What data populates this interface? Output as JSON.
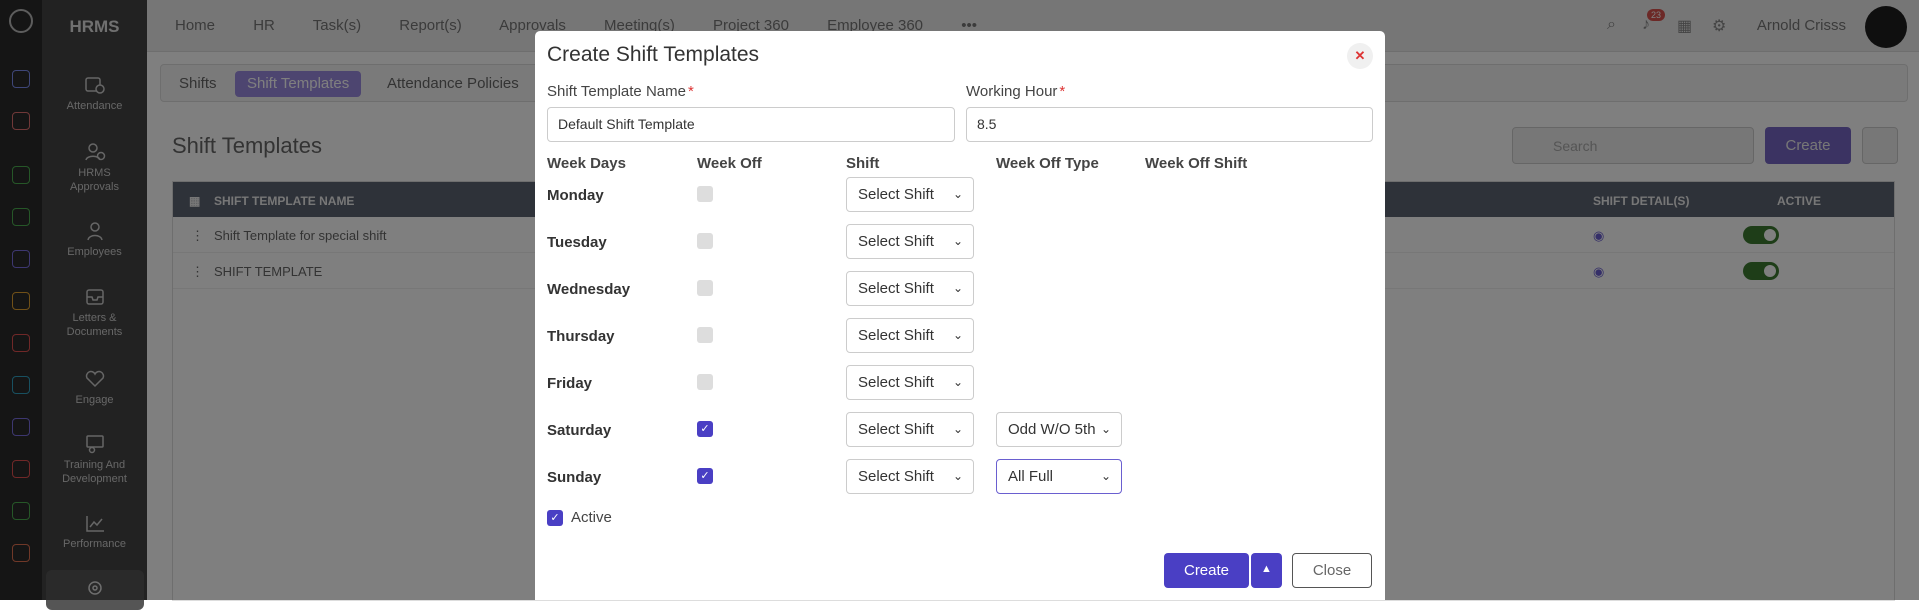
{
  "app": {
    "brand": "HRMS"
  },
  "sidebar": {
    "items": [
      {
        "label": "Attendance",
        "icon": "calendar-clock-icon"
      },
      {
        "label": "HRMS Approvals",
        "icon": "user-check-icon"
      },
      {
        "label": "Employees",
        "icon": "user-icon"
      },
      {
        "label": "Letters & Documents",
        "icon": "envelope-icon"
      },
      {
        "label": "Engage",
        "icon": "heart-hand-icon"
      },
      {
        "label": "Training And Development",
        "icon": "presentation-icon"
      },
      {
        "label": "Performance",
        "icon": "line-chart-icon"
      }
    ]
  },
  "topnav": {
    "items": [
      "Home",
      "HR",
      "Task(s)",
      "Report(s)",
      "Approvals",
      "Meeting(s)",
      "Project 360",
      "Employee 360"
    ],
    "notification_count": "23",
    "user_name": "Arnold Crisss"
  },
  "subtabs": {
    "items": [
      "Shifts",
      "Shift Templates",
      "Attendance Policies"
    ],
    "active": "Shift Templates"
  },
  "page": {
    "title": "Shift Templates",
    "search_placeholder": "Search",
    "create_label": "Create",
    "table": {
      "headers": {
        "name": "SHIFT TEMPLATE NAME",
        "details": "SHIFT DETAIL(S)",
        "active": "ACTIVE"
      },
      "rows": [
        {
          "name": "Shift Template for special shift",
          "active": true
        },
        {
          "name": "SHIFT TEMPLATE",
          "active": true
        }
      ]
    }
  },
  "modal": {
    "title": "Create Shift Templates",
    "name_label": "Shift Template Name",
    "name_value": "Default Shift Template",
    "hours_label": "Working Hour",
    "hours_value": "8.5",
    "columns": [
      "Week Days",
      "Week Off",
      "Shift",
      "Week Off Type",
      "Week Off Shift"
    ],
    "days": [
      {
        "day": "Monday",
        "week_off": false,
        "shift": "Select Shift",
        "week_off_type": ""
      },
      {
        "day": "Tuesday",
        "week_off": false,
        "shift": "Select Shift",
        "week_off_type": ""
      },
      {
        "day": "Wednesday",
        "week_off": false,
        "shift": "Select Shift",
        "week_off_type": ""
      },
      {
        "day": "Thursday",
        "week_off": false,
        "shift": "Select Shift",
        "week_off_type": ""
      },
      {
        "day": "Friday",
        "week_off": false,
        "shift": "Select Shift",
        "week_off_type": ""
      },
      {
        "day": "Saturday",
        "week_off": true,
        "shift": "Select Shift",
        "week_off_type": "Odd W/O 5th"
      },
      {
        "day": "Sunday",
        "week_off": true,
        "shift": "Select Shift",
        "week_off_type": "All Full"
      }
    ],
    "active_label": "Active",
    "active_checked": true,
    "create_label": "Create",
    "close_label": "Close"
  },
  "colors": {
    "accent": "#4a3fc4",
    "toggle": "#3c7a30",
    "required": "#d33"
  }
}
